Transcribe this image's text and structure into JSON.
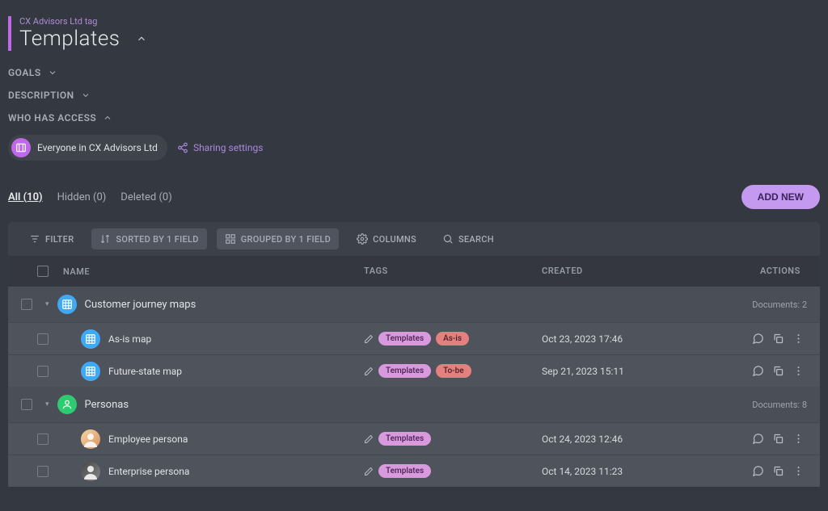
{
  "header": {
    "subtitle": "CX Advisors Ltd tag",
    "title": "Templates"
  },
  "sections": {
    "goals": "GOALS",
    "description": "DESCRIPTION",
    "access": "WHO HAS ACCESS"
  },
  "access": {
    "chip": "Everyone in CX Advisors Ltd",
    "sharing": "Sharing settings"
  },
  "tabs": {
    "all": "All (10)",
    "hidden": "Hidden (0)",
    "deleted": "Deleted (0)"
  },
  "addNew": "ADD NEW",
  "toolbar": {
    "filter": "FILTER",
    "sorted": "SORTED BY 1 FIELD",
    "grouped": "GROUPED BY 1 FIELD",
    "columns": "COLUMNS",
    "search": "SEARCH"
  },
  "columns": {
    "name": "NAME",
    "tags": "TAGS",
    "created": "CREATED",
    "actions": "ACTIONS"
  },
  "groups": [
    {
      "label": "Customer journey maps",
      "iconColor": "blue",
      "docCount": "Documents: 2",
      "rows": [
        {
          "name": "As-is map",
          "iconType": "blue",
          "tags": [
            "Templates",
            "As-is"
          ],
          "created": "Oct 23, 2023 17:46"
        },
        {
          "name": "Future-state map",
          "iconType": "blue",
          "tags": [
            "Templates",
            "To-be"
          ],
          "created": "Sep 21, 2023 15:11"
        }
      ]
    },
    {
      "label": "Personas",
      "iconColor": "green",
      "docCount": "Documents: 8",
      "rows": [
        {
          "name": "Employee persona",
          "iconType": "avatar1",
          "tags": [
            "Templates"
          ],
          "created": "Oct 24, 2023 12:46"
        },
        {
          "name": "Enterprise persona",
          "iconType": "avatar2",
          "tags": [
            "Templates"
          ],
          "created": "Oct 14, 2023 11:23"
        }
      ]
    }
  ]
}
